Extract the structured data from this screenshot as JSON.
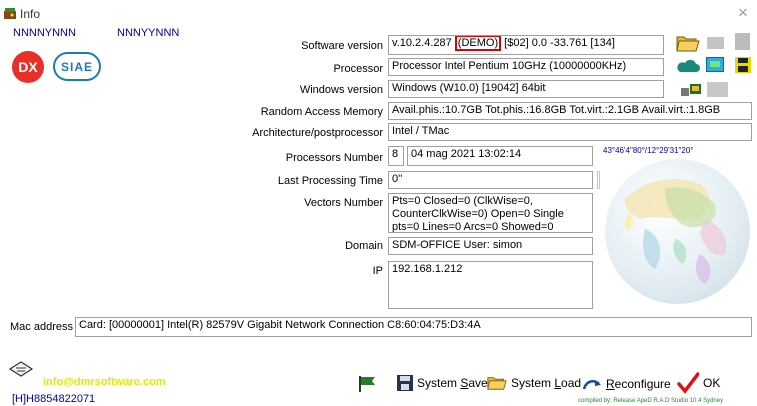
{
  "window": {
    "title": "Info",
    "close_glyph": "×"
  },
  "codes": {
    "left": "NNNNYNNN",
    "right": "NNNYYNNN"
  },
  "logos": {
    "dx": "DX",
    "siae": "SIAE"
  },
  "fields": {
    "software_version": {
      "label": "Software version",
      "value_prefix": "v.10.2.4.287 ",
      "highlight": "(DEMO)",
      "value_suffix": " [$02] 0.0 -33.761 [134]"
    },
    "processor": {
      "label": "Processor",
      "value": "Processor Intel Pentium 10GHz (10000000KHz)"
    },
    "windows_version": {
      "label": "Windows version",
      "value": "Windows (W10.0) [19042] 64bit"
    },
    "ram": {
      "label": "Random Access Memory",
      "value": "Avail.phis.:10.7GB Tot.phis.:16.8GB Tot.virt.:2.1GB Avail.virt.:1.8GB"
    },
    "architecture": {
      "label": "Architecture/postprocessor",
      "value": "Intel / TMac"
    },
    "processors_number": {
      "label": "Processors Number",
      "count": "8",
      "datetime": "04 mag 2021 13:02:14"
    },
    "last_processing": {
      "label": "Last Processing Time",
      "value": "0''"
    },
    "vectors_number": {
      "label": "Vectors Number",
      "value": "Pts=0 Closed=0 (ClkWise=0, CounterClkWise=0) Open=0 Single pts=0 Lines=0 Arcs=0 Showed=0"
    },
    "domain": {
      "label": "Domain",
      "value": "SDM-OFFICE User: simon"
    },
    "ip": {
      "label": "IP",
      "value": "192.168.1.212"
    },
    "mac": {
      "label": "Mac address",
      "value": "Card: [00000001] Intel(R) 82579V Gigabit Network Connection C8:60:04:75:D3:4A"
    }
  },
  "globe": {
    "coords": "43°46'4\"80°/12°29'31\"20°"
  },
  "footer": {
    "email": "info@dmrsoftware.com",
    "phone": "[H]H8854822071",
    "compiled_text": "compiled by: Release ApeD R.A.D Studio 10.4 Sydney",
    "buttons": {
      "save_pre": "System ",
      "save_ul": "S",
      "save_post": "ave",
      "load_pre": "System ",
      "load_ul": "L",
      "load_post": "oad",
      "reconf_ul": "R",
      "reconf_post": "econfigure",
      "ok": "OK"
    }
  },
  "colors": {
    "highlight_border": "#e00000",
    "link_blue": "#0000aa",
    "email_yellow": "#e8e800",
    "footer_green": "#2a8a2a"
  }
}
